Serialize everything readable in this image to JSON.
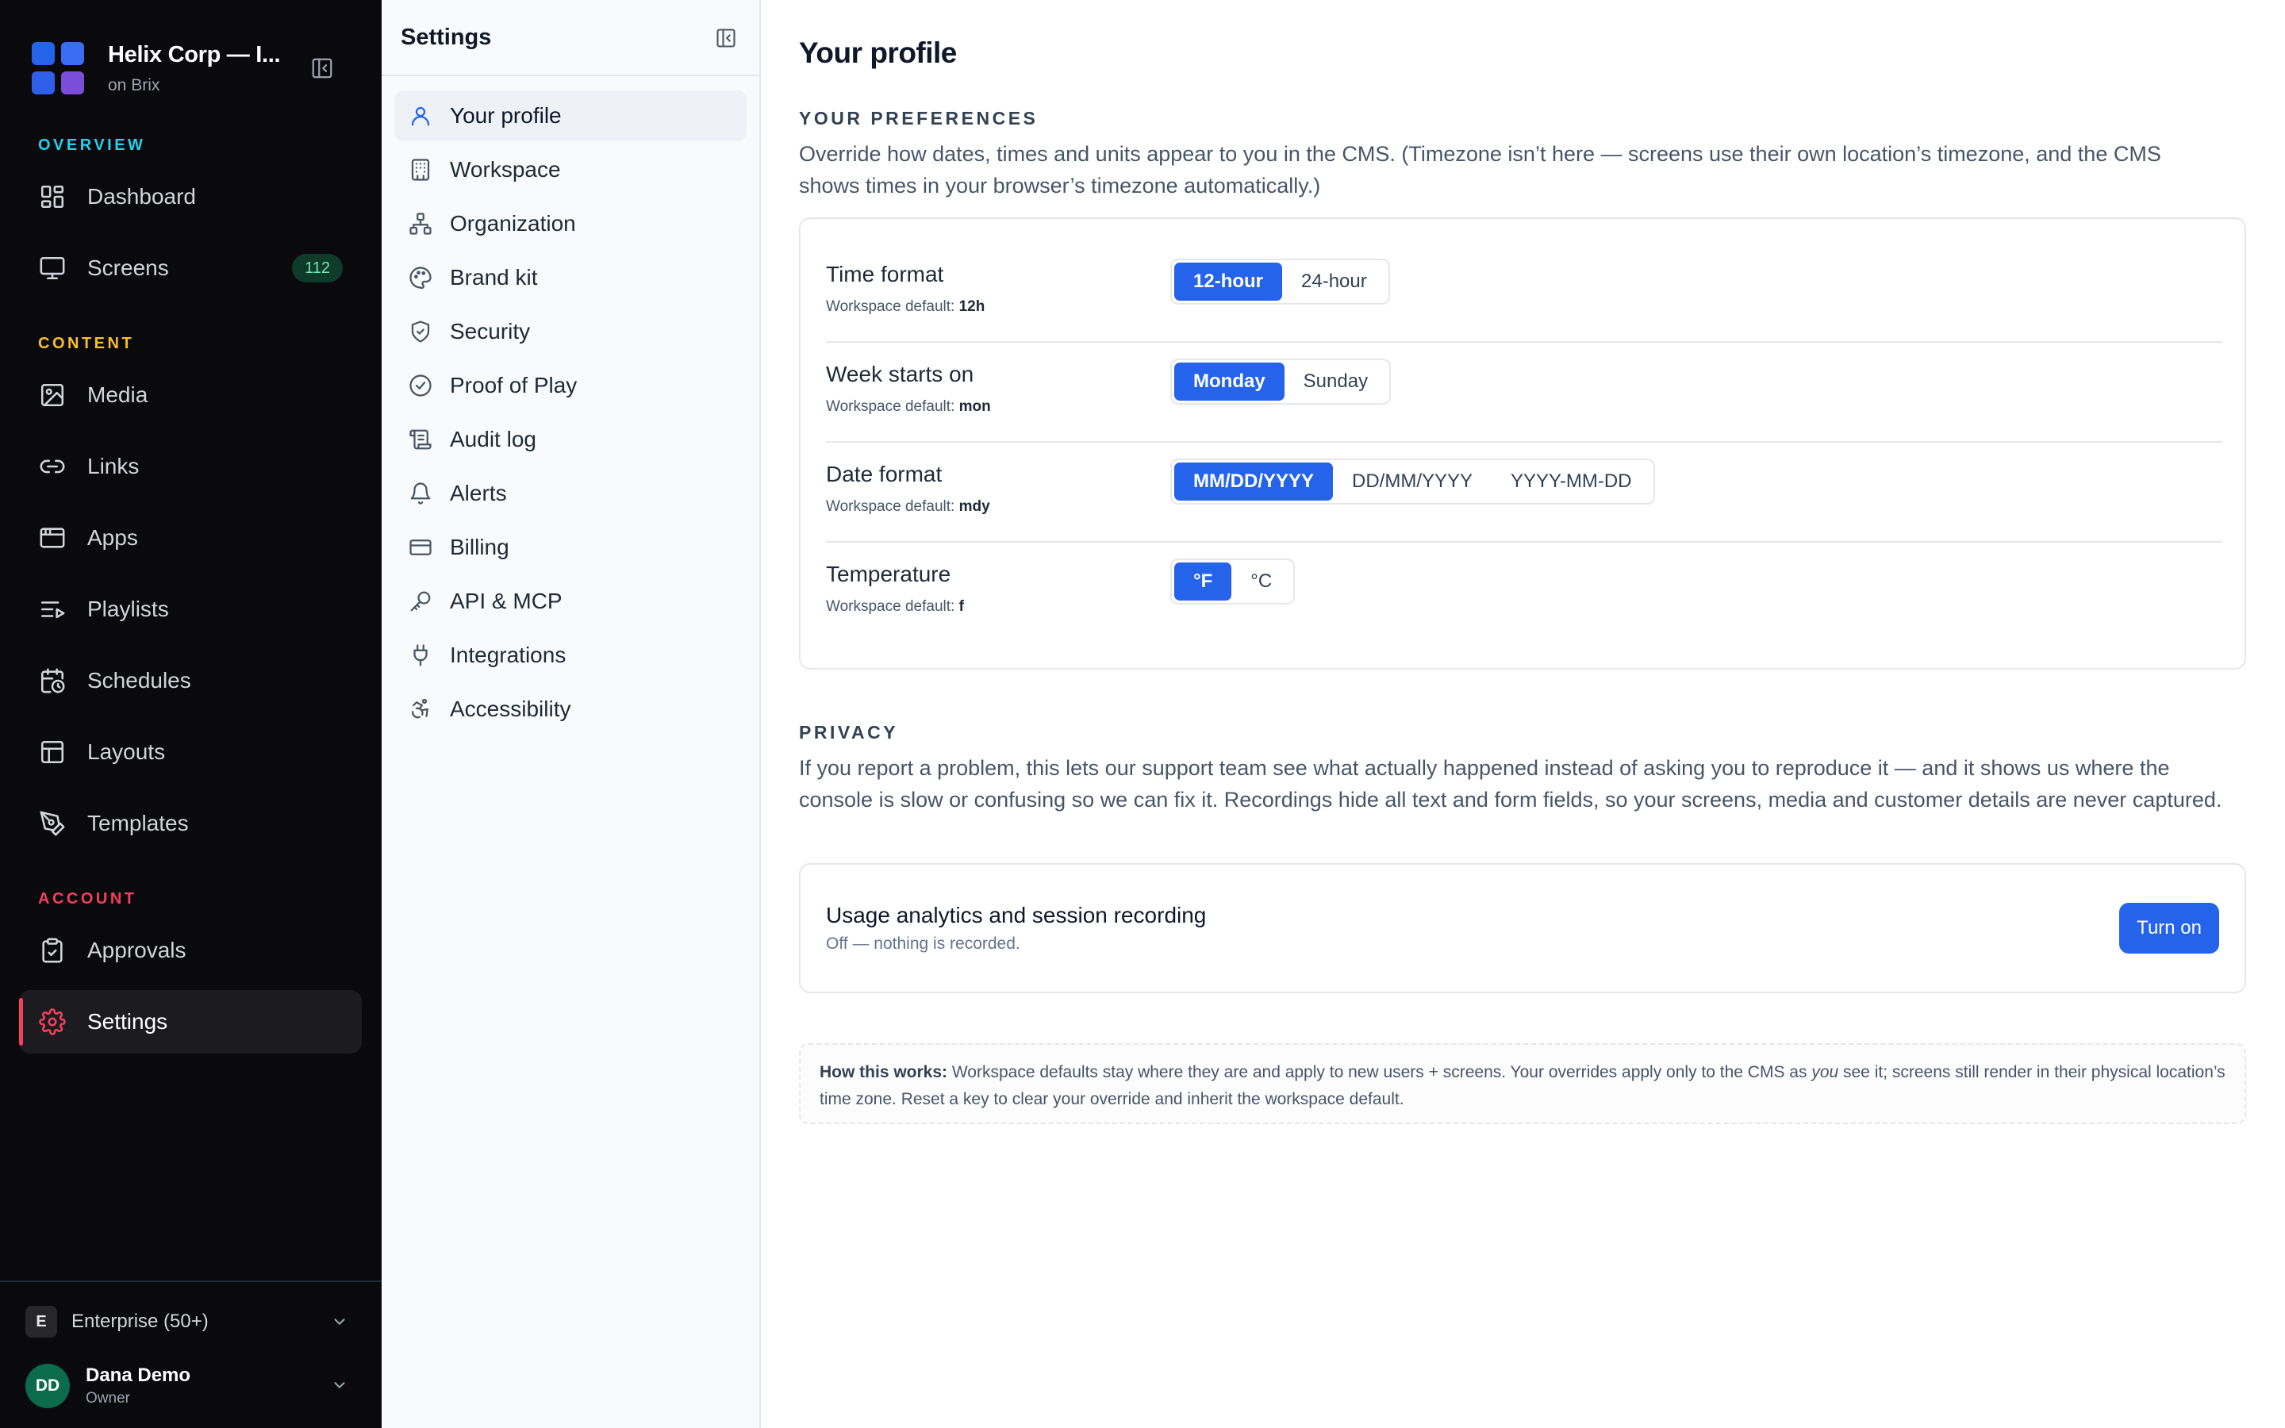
{
  "brand": {
    "title": "Helix Corp — I...",
    "subtitle": "on Brix"
  },
  "sidebar": {
    "sections": [
      {
        "label": "OVERVIEW",
        "color": "#22d3ee"
      },
      {
        "label": "CONTENT",
        "color": "#fbbf24"
      },
      {
        "label": "ACCOUNT",
        "color": "#f43f5e"
      }
    ],
    "items": [
      {
        "label": "Dashboard",
        "icon": "grid-icon"
      },
      {
        "label": "Screens",
        "icon": "monitor-icon",
        "badge": "112"
      },
      {
        "label": "Media",
        "icon": "image-icon"
      },
      {
        "label": "Links",
        "icon": "link-icon"
      },
      {
        "label": "Apps",
        "icon": "app-window-icon"
      },
      {
        "label": "Playlists",
        "icon": "playlist-icon"
      },
      {
        "label": "Schedules",
        "icon": "calendar-clock-icon"
      },
      {
        "label": "Layouts",
        "icon": "layout-icon"
      },
      {
        "label": "Templates",
        "icon": "pen-tool-icon"
      },
      {
        "label": "Approvals",
        "icon": "clipboard-check-icon"
      },
      {
        "label": "Settings",
        "icon": "gear-icon",
        "active": true
      }
    ],
    "footer": {
      "plan_chip": "E",
      "plan_label": "Enterprise (50+)",
      "avatar_initials": "DD",
      "user_name": "Dana Demo",
      "user_role": "Owner"
    }
  },
  "settings_nav": {
    "title": "Settings",
    "items": [
      {
        "label": "Your profile",
        "icon": "user-icon",
        "active": true
      },
      {
        "label": "Workspace",
        "icon": "building-icon"
      },
      {
        "label": "Organization",
        "icon": "org-chart-icon"
      },
      {
        "label": "Brand kit",
        "icon": "palette-icon"
      },
      {
        "label": "Security",
        "icon": "shield-icon"
      },
      {
        "label": "Proof of Play",
        "icon": "check-circle-icon"
      },
      {
        "label": "Audit log",
        "icon": "scroll-icon"
      },
      {
        "label": "Alerts",
        "icon": "bell-icon"
      },
      {
        "label": "Billing",
        "icon": "credit-card-icon"
      },
      {
        "label": "API & MCP",
        "icon": "key-icon"
      },
      {
        "label": "Integrations",
        "icon": "plug-icon"
      },
      {
        "label": "Accessibility",
        "icon": "accessibility-icon"
      }
    ]
  },
  "main": {
    "title": "Your profile",
    "preferences": {
      "label": "YOUR PREFERENCES",
      "description": "Override how dates, times and units appear to you in the CMS. (Timezone isn’t here — screens use their own location’s timezone, and the CMS shows times in your browser’s timezone automatically.)",
      "rows": [
        {
          "label": "Time format",
          "default_prefix": "Workspace default:",
          "default_value": "12h",
          "options": [
            "12-hour",
            "24-hour"
          ],
          "selected": "12-hour"
        },
        {
          "label": "Week starts on",
          "default_prefix": "Workspace default:",
          "default_value": "mon",
          "options": [
            "Monday",
            "Sunday"
          ],
          "selected": "Monday"
        },
        {
          "label": "Date format",
          "default_prefix": "Workspace default:",
          "default_value": "mdy",
          "options": [
            "MM/DD/YYYY",
            "DD/MM/YYYY",
            "YYYY-MM-DD"
          ],
          "selected": "MM/DD/YYYY"
        },
        {
          "label": "Temperature",
          "default_prefix": "Workspace default:",
          "default_value": "f",
          "options": [
            "°F",
            "°C"
          ],
          "selected": "°F"
        }
      ]
    },
    "privacy": {
      "label": "PRIVACY",
      "description": "If you report a problem, this lets our support team see what actually happened instead of asking you to reproduce it — and it shows us where the console is slow or confusing so we can fix it. Recordings hide all text and form fields, so your screens, media and customer details are never captured.",
      "card_title": "Usage analytics and session recording",
      "card_status": "Off — nothing is recorded.",
      "button_label": "Turn on"
    },
    "note": {
      "bold": "How this works:",
      "text1": " Workspace defaults stay where they are and apply to new users + screens. Your overrides apply only to the CMS as ",
      "em": "you",
      "text2": " see it; screens still render in their physical location’s time zone. Reset a key to clear your override and inherit the workspace default."
    }
  },
  "colors": {
    "accent": "#2563eb",
    "sidebar_bg": "#0a0a0c",
    "active_marker": "#f43f5e",
    "badge_text": "#6ee7b7"
  }
}
